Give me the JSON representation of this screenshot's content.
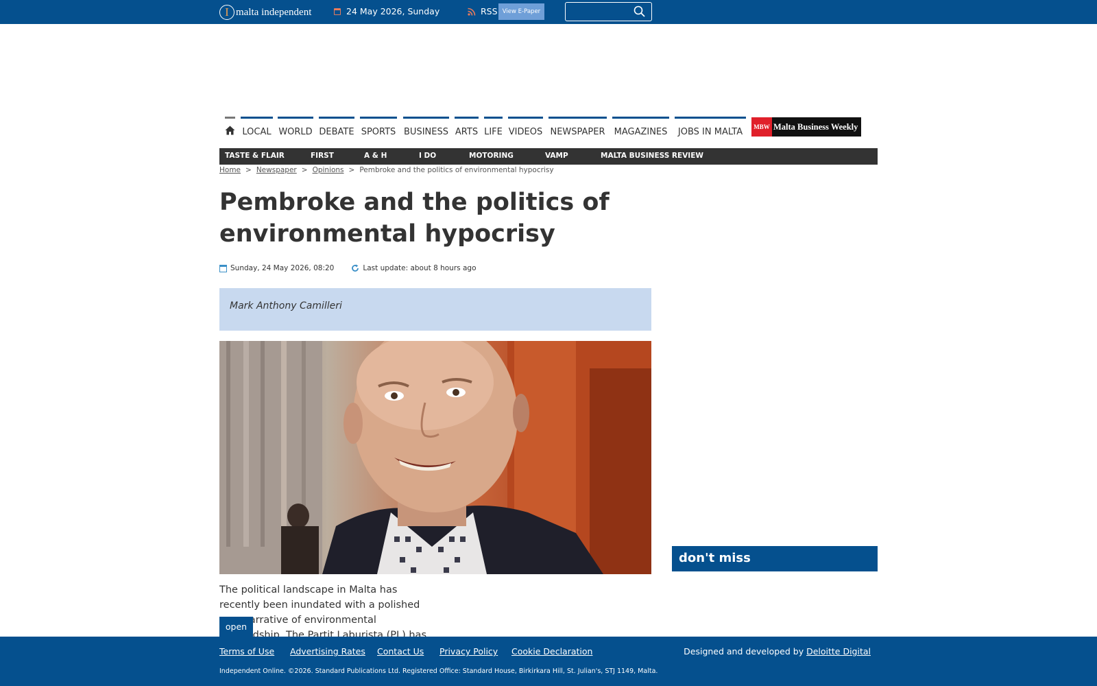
{
  "topbar": {
    "logo_initial": "I",
    "logo_text": "malta independent",
    "date": "24 May 2026, Sunday",
    "rss_label": "RSS",
    "epaper_label": "View E-Paper",
    "search_placeholder": "",
    "colors": {
      "bar": "#05508e",
      "epaper": "#6f9fd8"
    }
  },
  "nav": {
    "items": [
      "LOCAL",
      "WORLD",
      "DEBATE",
      "SPORTS",
      "BUSINESS",
      "ARTS",
      "LIFE",
      "VIDEOS",
      "NEWSPAPER",
      "MAGAZINES",
      "JOBS IN MALTA"
    ],
    "home_icon": "home-icon",
    "mbw_mark": "MBW",
    "mbw_text": "Malta Business Weekly"
  },
  "subnav": {
    "items": [
      "TASTE & FLAIR",
      "FIRST",
      "A & H",
      "I DO",
      "MOTORING",
      "VAMP",
      "MALTA BUSINESS REVIEW"
    ]
  },
  "breadcrumb": {
    "home": "Home",
    "newspaper": "Newspaper",
    "opinions": "Opinions",
    "current": "Pembroke and the politics of environmental hypocrisy",
    "sep": ">"
  },
  "article": {
    "title": "Pembroke and the politics of environmental hypocrisy",
    "published": "Sunday, 24 May 2026, 08:20",
    "last_update": "Last update: about 8 hours ago",
    "author": "Mark Anthony Camilleri",
    "body": "The political landscape in Malta has recently been inundated with a polished new narrative of environmental stewardship. The Partit Laburista (PL) has unveiled a suite of",
    "open_label": "open"
  },
  "sidebar": {
    "dont_miss": "don't miss"
  },
  "footer": {
    "links": [
      "Terms of Use",
      "Advertising Rates",
      "Contact Us",
      "Privacy Policy",
      "Cookie Declaration"
    ],
    "designed_by_label": "Designed and developed by",
    "designed_by_link": "Deloitte Digital",
    "copyright": "Independent Online. ©2026. Standard Publications Ltd. Registered Office: Standard House, Birkirkara Hill, St. Julian's, STJ 1149, Malta."
  }
}
